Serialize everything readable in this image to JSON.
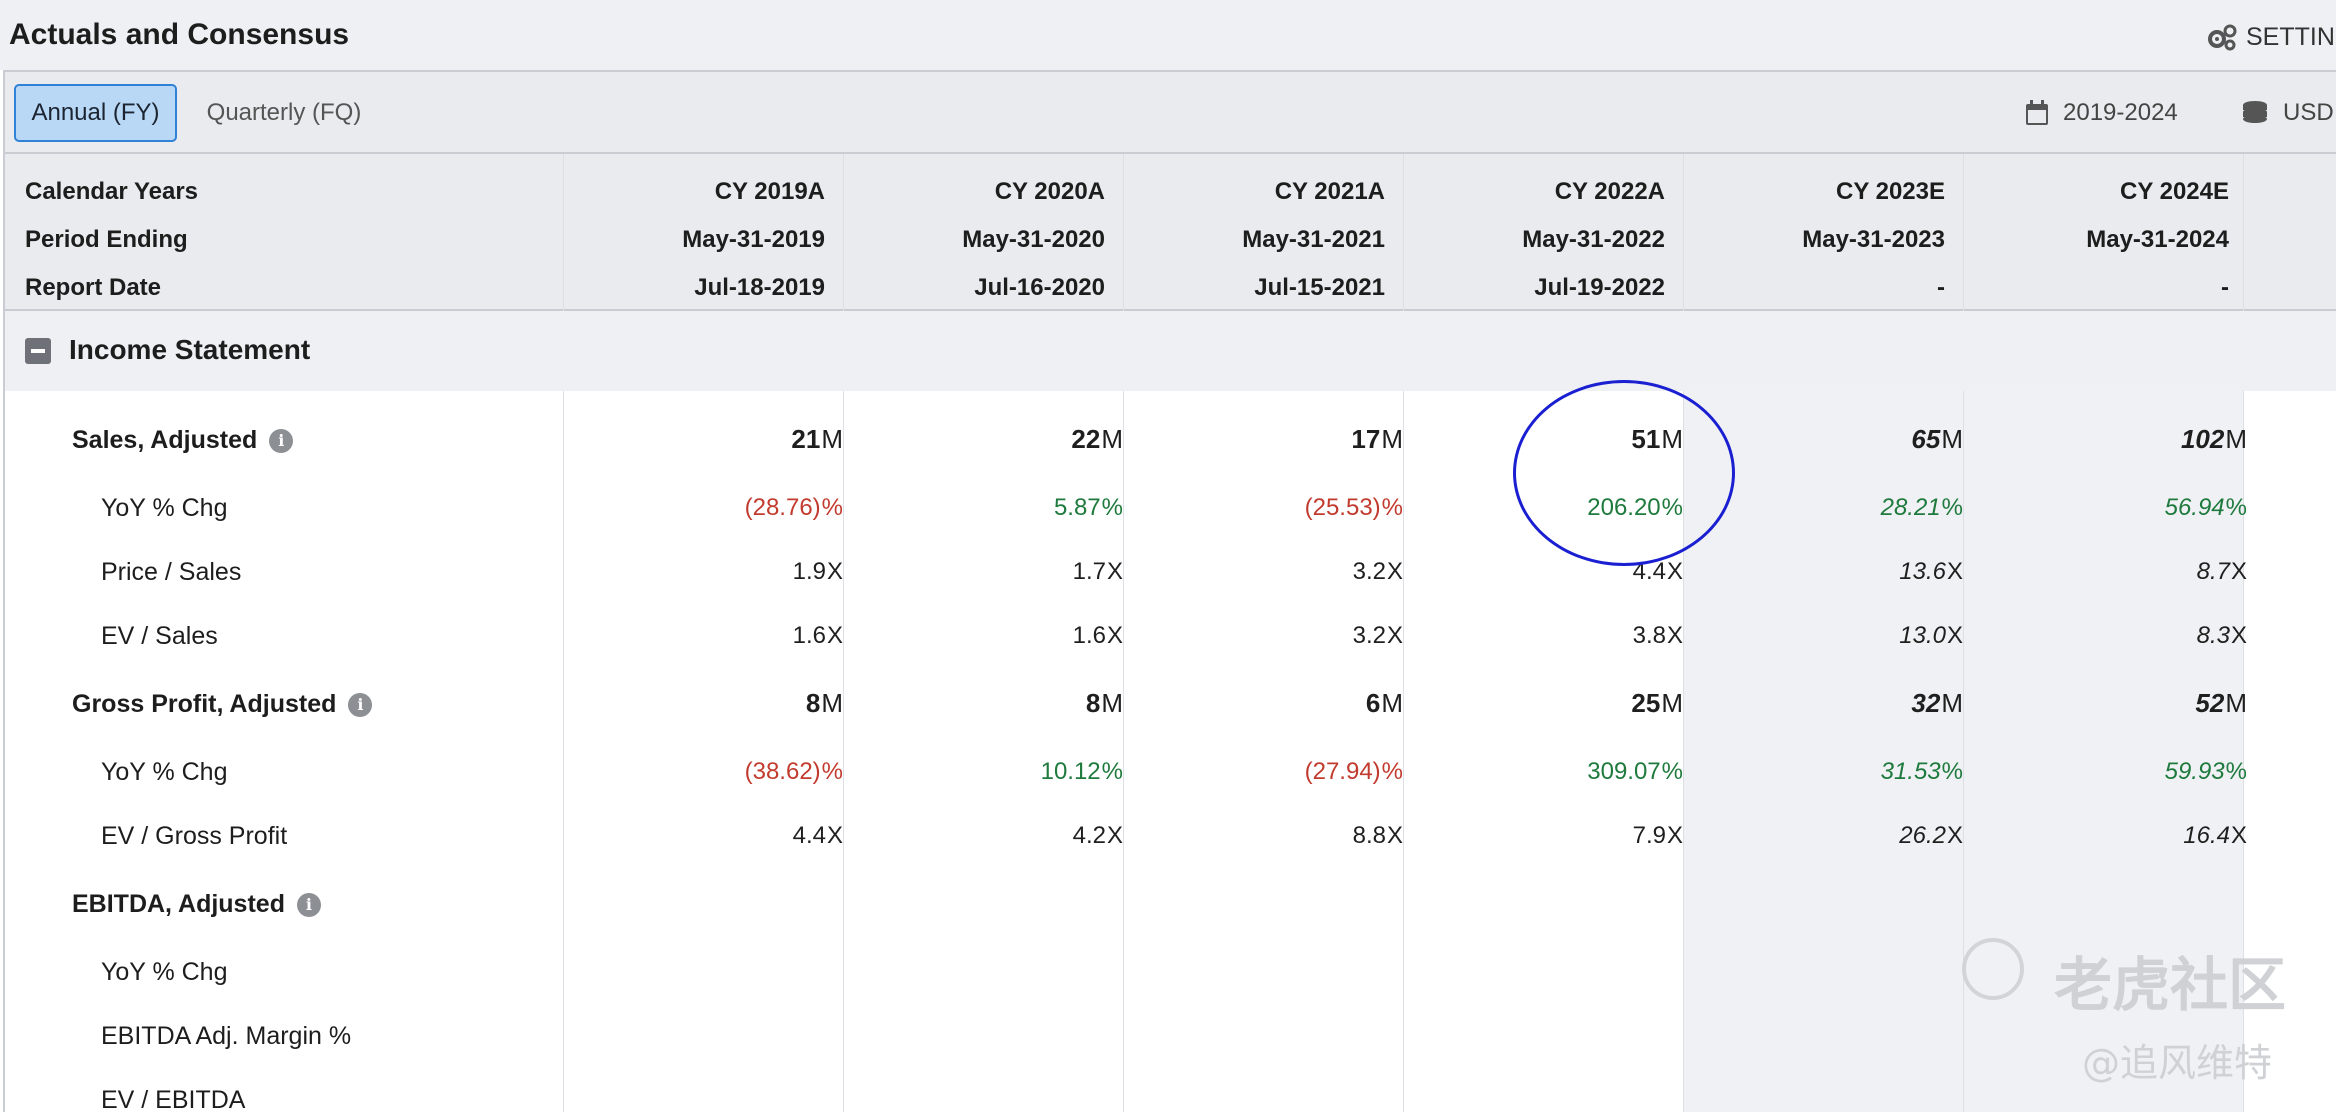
{
  "header": {
    "title": "Actuals and Consensus",
    "settings_label": "SETTIN",
    "settings_icon": "gears-icon"
  },
  "toolbar": {
    "tabs": [
      {
        "label": "Annual (FY)",
        "active": true
      },
      {
        "label": "Quarterly (FQ)",
        "active": false
      }
    ],
    "range_label": "2019-2024",
    "range_icon": "calendar-icon",
    "currency_label": "USD",
    "currency_icon": "coins-icon"
  },
  "columns_header": {
    "row_labels": [
      "Calendar Years",
      "Period Ending",
      "Report Date"
    ],
    "columns": [
      {
        "year": "CY 2019A",
        "period_ending": "May-31-2019",
        "report_date": "Jul-18-2019",
        "estimate": false
      },
      {
        "year": "CY 2020A",
        "period_ending": "May-31-2020",
        "report_date": "Jul-16-2020",
        "estimate": false
      },
      {
        "year": "CY 2021A",
        "period_ending": "May-31-2021",
        "report_date": "Jul-15-2021",
        "estimate": false
      },
      {
        "year": "CY 2022A",
        "period_ending": "May-31-2022",
        "report_date": "Jul-19-2022",
        "estimate": false
      },
      {
        "year": "CY 2023E",
        "period_ending": "May-31-2023",
        "report_date": "-",
        "estimate": true
      },
      {
        "year": "CY 2024E",
        "period_ending": "May-31-2024",
        "report_date": "-",
        "estimate": true
      }
    ]
  },
  "section": {
    "title": "Income Statement",
    "rows": [
      {
        "label": "Sales, Adjusted",
        "type": "main",
        "info": true,
        "unit": "M",
        "values": [
          "21",
          "22",
          "17",
          "51",
          "65",
          "102"
        ],
        "tone": [
          "",
          "",
          "",
          "",
          "",
          ""
        ]
      },
      {
        "label": "YoY % Chg",
        "type": "sub",
        "info": false,
        "unit": "%",
        "values": [
          "(28.76)",
          "5.87",
          "(25.53)",
          "206.20",
          "28.21",
          "56.94"
        ],
        "tone": [
          "neg",
          "pos",
          "neg",
          "pos",
          "pos",
          "pos"
        ]
      },
      {
        "label": "Price / Sales",
        "type": "sub",
        "info": false,
        "unit": "X",
        "values": [
          "1.9",
          "1.7",
          "3.2",
          "4.4",
          "13.6",
          "8.7"
        ],
        "tone": [
          "",
          "",
          "",
          "",
          "",
          ""
        ]
      },
      {
        "label": "EV / Sales",
        "type": "sub",
        "info": false,
        "unit": "X",
        "values": [
          "1.6",
          "1.6",
          "3.2",
          "3.8",
          "13.0",
          "8.3"
        ],
        "tone": [
          "",
          "",
          "",
          "",
          "",
          ""
        ]
      },
      {
        "label": "Gross Profit, Adjusted",
        "type": "main",
        "info": true,
        "unit": "M",
        "values": [
          "8",
          "8",
          "6",
          "25",
          "32",
          "52"
        ],
        "tone": [
          "",
          "",
          "",
          "",
          "",
          ""
        ]
      },
      {
        "label": "YoY % Chg",
        "type": "sub",
        "info": false,
        "unit": "%",
        "values": [
          "(38.62)",
          "10.12",
          "(27.94)",
          "309.07",
          "31.53",
          "59.93"
        ],
        "tone": [
          "neg",
          "pos",
          "neg",
          "pos",
          "pos",
          "pos"
        ]
      },
      {
        "label": "EV / Gross Profit",
        "type": "sub",
        "info": false,
        "unit": "X",
        "values": [
          "4.4",
          "4.2",
          "8.8",
          "7.9",
          "26.2",
          "16.4"
        ],
        "tone": [
          "",
          "",
          "",
          "",
          "",
          ""
        ]
      },
      {
        "label": "EBITDA, Adjusted",
        "type": "main",
        "info": true,
        "unit": "",
        "values": [
          "",
          "",
          "",
          "",
          "",
          ""
        ],
        "tone": [
          "",
          "",
          "",
          "",
          "",
          ""
        ]
      },
      {
        "label": "YoY % Chg",
        "type": "sub",
        "info": false,
        "unit": "",
        "values": [
          "",
          "",
          "",
          "",
          "",
          ""
        ],
        "tone": [
          "",
          "",
          "",
          "",
          "",
          ""
        ]
      },
      {
        "label": "EBITDA Adj. Margin %",
        "type": "sub",
        "info": false,
        "unit": "",
        "values": [
          "",
          "",
          "",
          "",
          "",
          ""
        ],
        "tone": [
          "",
          "",
          "",
          "",
          "",
          ""
        ]
      },
      {
        "label": "EV / EBITDA",
        "type": "sub",
        "info": false,
        "unit": "",
        "values": [
          "",
          "",
          "",
          "",
          "",
          ""
        ],
        "tone": [
          "",
          "",
          "",
          "",
          "",
          ""
        ]
      }
    ]
  },
  "watermark": {
    "brand": "老虎社区",
    "handle": "@追风维特"
  }
}
